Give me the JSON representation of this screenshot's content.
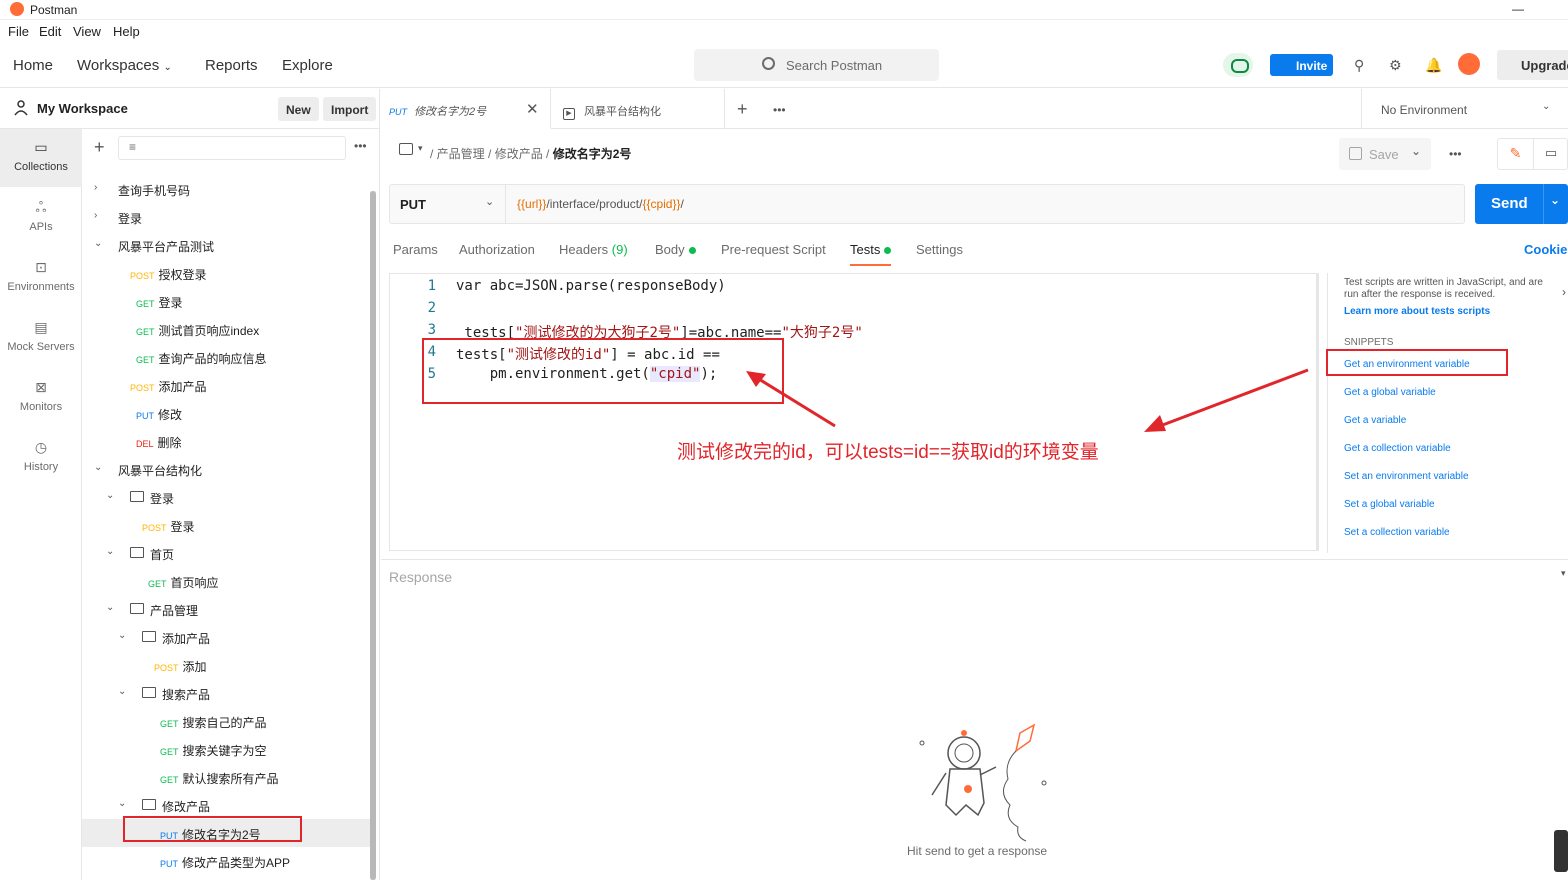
{
  "app": {
    "title": "Postman"
  },
  "menu": [
    "File",
    "Edit",
    "View",
    "Help"
  ],
  "topnav": {
    "home": "Home",
    "workspaces": "Workspaces",
    "reports": "Reports",
    "explore": "Explore",
    "search_placeholder": "Search Postman",
    "invite": "Invite",
    "upgrade": "Upgrade"
  },
  "workspace": {
    "name": "My Workspace",
    "new_label": "New",
    "import_label": "Import"
  },
  "leftnav": [
    "Collections",
    "APIs",
    "Environments",
    "Mock Servers",
    "Monitors",
    "History"
  ],
  "tree": [
    {
      "label": "查询手机号码"
    },
    {
      "label": "登录"
    },
    {
      "label": "风暴平台产品测试"
    },
    {
      "method": "POST",
      "label": "授权登录"
    },
    {
      "method": "GET",
      "label": "登录"
    },
    {
      "method": "GET",
      "label": "测试首页响应index"
    },
    {
      "method": "GET",
      "label": "查询产品的响应信息"
    },
    {
      "method": "POST",
      "label": "添加产品"
    },
    {
      "method": "PUT",
      "label": "修改"
    },
    {
      "method": "DEL",
      "label": "删除"
    },
    {
      "label": "风暴平台结构化"
    },
    {
      "label": "登录"
    },
    {
      "method": "POST",
      "label": "登录"
    },
    {
      "label": "首页"
    },
    {
      "method": "GET",
      "label": "首页响应"
    },
    {
      "label": "产品管理"
    },
    {
      "label": "添加产品"
    },
    {
      "method": "POST",
      "label": "添加"
    },
    {
      "label": "搜索产品"
    },
    {
      "method": "GET",
      "label": "搜索自己的产品"
    },
    {
      "method": "GET",
      "label": "搜索关键字为空"
    },
    {
      "method": "GET",
      "label": "默认搜索所有产品"
    },
    {
      "label": "修改产品"
    },
    {
      "method": "PUT",
      "label": "修改名字为2号"
    },
    {
      "method": "PUT",
      "label": "修改产品类型为APP"
    }
  ],
  "tabs": [
    {
      "method": "PUT",
      "label": "修改名字为2号"
    },
    {
      "label": "风暴平台结构化"
    }
  ],
  "environment": "No Environment",
  "breadcrumb": {
    "a": "产品管理",
    "b": "修改产品",
    "current": "修改名字为2号"
  },
  "save_label": "Save",
  "request": {
    "method": "PUT",
    "url_var1": "{{url}}",
    "url_mid": "/interface/product/",
    "url_var2": "{{cpid}}",
    "url_end": "/",
    "send": "Send"
  },
  "reqtabs": {
    "params": "Params",
    "auth": "Authorization",
    "headers": "Headers",
    "headers_count": "(9)",
    "body": "Body",
    "prereq": "Pre-request Script",
    "tests": "Tests",
    "settings": "Settings",
    "cookies": "Cookies"
  },
  "code": {
    "n1": "1",
    "l1": "var abc=JSON.parse(responseBody)",
    "n2": "2",
    "l2": "",
    "n3": "3",
    "l3a": " tests[",
    "l3b": "\"测试修改的为大狗子2号\"",
    "l3c": "]=abc.name==",
    "l3d": "\"大狗子2号\"",
    "n4": "4",
    "l4a": "tests[",
    "l4b": "\"测试修改的id\"",
    "l4c": "] = abc.id ==",
    "n5": "5",
    "l5a": "    pm.environment.get(",
    "l5b": "\"cpid\"",
    "l5c": ");"
  },
  "snippets": {
    "desc": "Test scripts are written in JavaScript, and are run after the response is received.",
    "learn": "Learn more about tests scripts",
    "header": "SNIPPETS",
    "items": [
      "Get an environment variable",
      "Get a global variable",
      "Get a variable",
      "Get a collection variable",
      "Set an environment variable",
      "Set a global variable",
      "Set a collection variable"
    ]
  },
  "response": {
    "label": "Response",
    "hint": "Hit send to get a response"
  },
  "annotation": "测试修改完的id，可以tests=id==获取id的环境变量",
  "colors": {
    "accent": "#ff6c37",
    "send": "#097bed",
    "annotation": "#e1262b"
  }
}
